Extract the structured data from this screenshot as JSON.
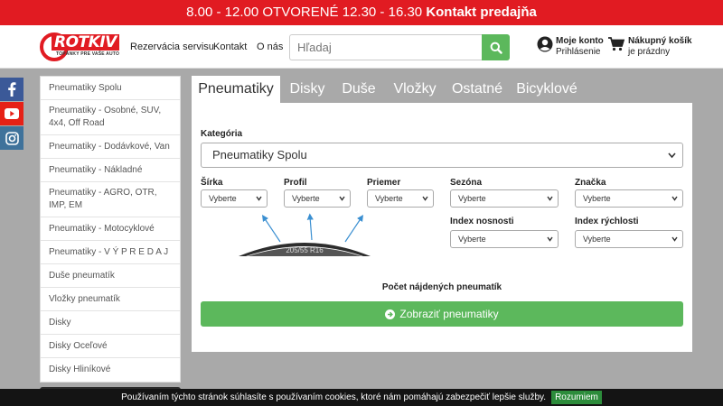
{
  "topbar": {
    "hours": "8.00 - 12.00 OTVORENÉ 12.30 - 16.30",
    "contact": "Kontakt predajňa"
  },
  "header": {
    "logo_text": "ROTKIV",
    "logo_sub": "TOPÁNKY PRE VAŠE AUTO",
    "nav": [
      "Rezervácia servisu",
      "Kontakt",
      "O nás"
    ],
    "search_placeholder": "Hľadaj",
    "account_title": "Moje konto",
    "account_sub": "Prihlásenie",
    "cart_title": "Nákupný košík",
    "cart_sub": "je prázdny"
  },
  "sidebar": {
    "items": [
      {
        "label": "Pneumatiky Spolu"
      },
      {
        "label": "Pneumatiky - Osobné, SUV, 4x4, Off Road"
      },
      {
        "label": "Pneumatiky - Dodávkové, Van"
      },
      {
        "label": "Pneumatiky - Nákladné"
      },
      {
        "label": "Pneumatiky - AGRO, OTR, IMP, EM"
      },
      {
        "label": "Pneumatiky - Motocyklové"
      },
      {
        "label": "Pneumatiky - V Ý P R E D A J"
      },
      {
        "label": "Duše pneumatík"
      },
      {
        "label": "Vložky pneumatík"
      },
      {
        "label": "Disky"
      },
      {
        "label": "Disky Oceľové"
      },
      {
        "label": "Disky Hliníkové"
      }
    ]
  },
  "tabs": [
    "Pneumatiky",
    "Disky",
    "Duše",
    "Vložky",
    "Ostatné",
    "Bicyklové"
  ],
  "filter": {
    "category_label": "Kategória",
    "category_value": "Pneumatiky Spolu",
    "width_label": "Šírka",
    "profile_label": "Profil",
    "diameter_label": "Priemer",
    "season_label": "Sezóna",
    "brand_label": "Značka",
    "load_label": "Index nosnosti",
    "speed_label": "Index rýchlosti",
    "placeholder": "Vyberte",
    "tire_size": "205/55 R16",
    "count_label": "Počet nájdených pneumatík",
    "show_button": "Zobraziť pneumatiky"
  },
  "cookie": {
    "text": "Používaním týchto stránok súhlasíte s používaním cookies, ktoré nám pomáhajú zabezpečiť lepšie služby.",
    "button": "Rozumiem"
  },
  "colors": {
    "brand_red": "#e11b22",
    "accent_green": "#5cb85c",
    "background": "#a9a9a9"
  }
}
